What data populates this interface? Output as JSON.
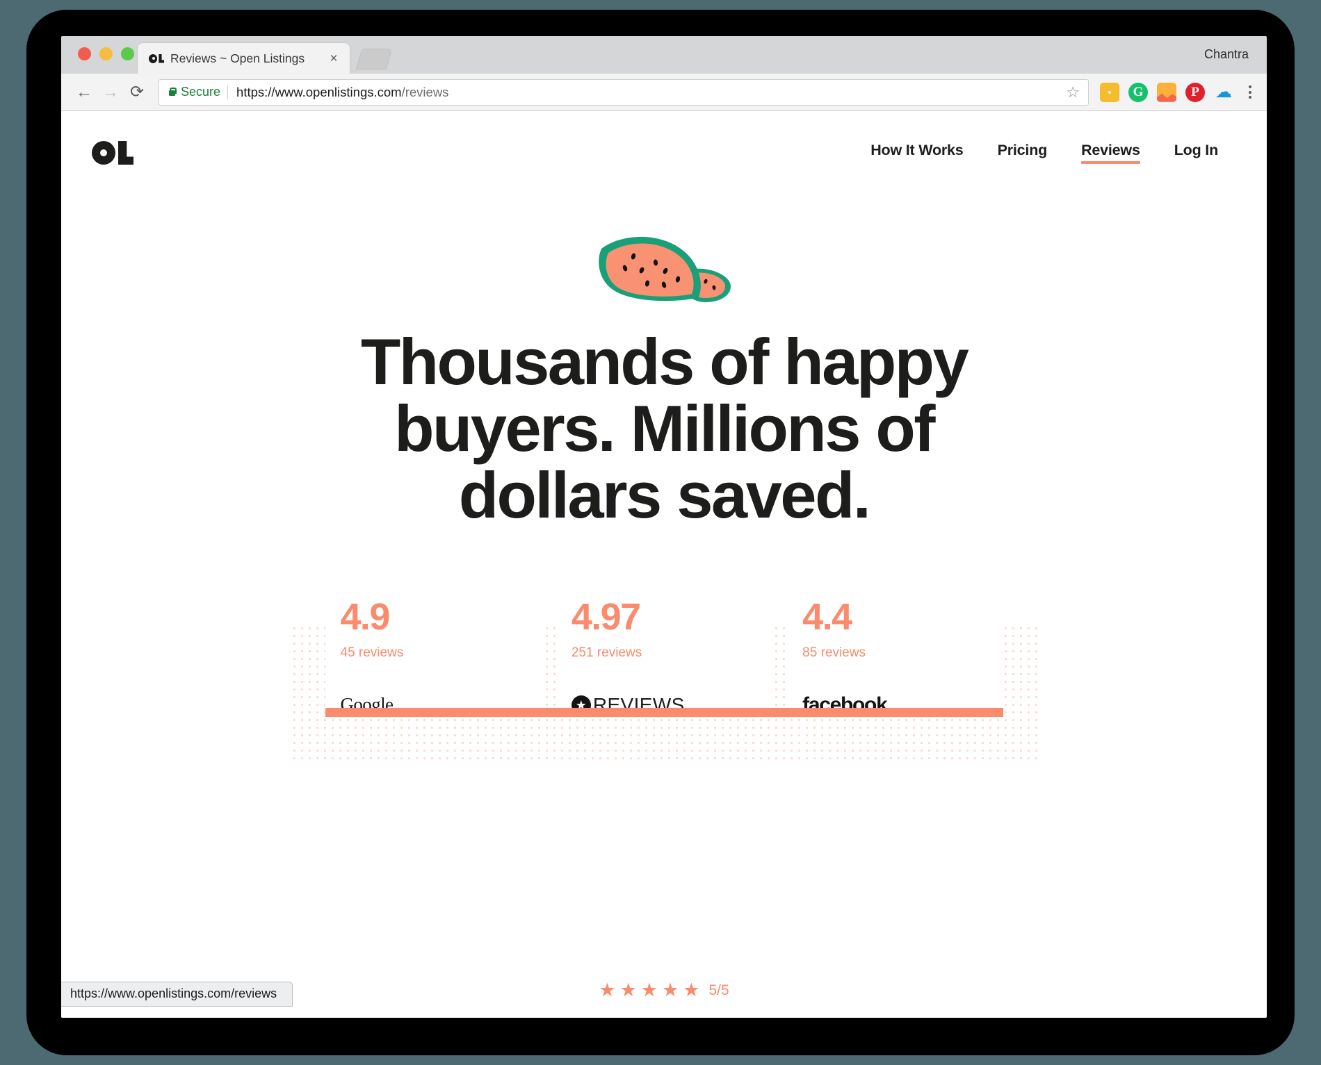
{
  "browser": {
    "profile_name": "Chantra",
    "tab": {
      "title": "Reviews ~ Open Listings",
      "favicon": "ol-logo-favicon",
      "close_label": "×"
    },
    "newtab_label": "",
    "nav": {
      "back": "←",
      "forward": "→",
      "reload": "⟳"
    },
    "omnibox": {
      "security_label": "Secure",
      "url_host": "https://www.openlistings.com",
      "url_path": "/reviews",
      "bookmark_icon": "☆"
    },
    "extensions": [
      {
        "name": "dots-extension-icon",
        "glyph": ""
      },
      {
        "name": "grammarly-extension-icon",
        "glyph": "G"
      },
      {
        "name": "chart-extension-icon",
        "glyph": ""
      },
      {
        "name": "pinterest-extension-icon",
        "glyph": "P"
      },
      {
        "name": "salesforce-extension-icon",
        "glyph": "☁"
      }
    ],
    "menu_icon": "kebab-menu-icon",
    "status_bar_url": "https://www.openlistings.com/reviews"
  },
  "site": {
    "logo_alt": "OL",
    "nav_items": [
      {
        "label": "How It Works",
        "active": false
      },
      {
        "label": "Pricing",
        "active": false
      },
      {
        "label": "Reviews",
        "active": true
      },
      {
        "label": "Log In",
        "active": false
      }
    ],
    "hero": {
      "illustration": "watermelon-slice-illustration",
      "headline": "Thousands of happy buyers. Millions of dollars saved."
    },
    "ratings": [
      {
        "score": "4.9",
        "count": "45 reviews",
        "brand": "Google",
        "brand_icon": "google-wordmark"
      },
      {
        "score": "4.97",
        "count": "251 reviews",
        "brand": "REVIEWS",
        "brand_icon": "reviews-star-badge"
      },
      {
        "score": "4.4",
        "count": "85 reviews",
        "brand": "facebook.",
        "brand_icon": "facebook-wordmark"
      }
    ],
    "bottom_rating": {
      "stars": "★★★★★",
      "ratio": "5/5",
      "star_count": 5
    },
    "colors": {
      "coral": "#fa8b6c",
      "coral_light": "#fbd9cd",
      "ink": "#1d1d1b",
      "melon_rind": "#1aa078",
      "melon_flesh": "#f99273"
    }
  }
}
